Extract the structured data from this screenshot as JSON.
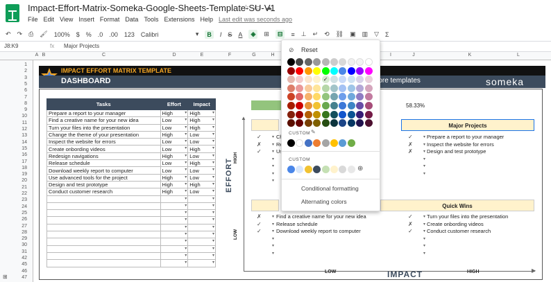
{
  "window": {
    "title": "Impact-Effort-Matrix-Someka-Google-Sheets-Template-SU-V1"
  },
  "menu": [
    "File",
    "Edit",
    "View",
    "Insert",
    "Format",
    "Data",
    "Tools",
    "Extensions",
    "Help"
  ],
  "last_edit": "Last edit was seconds ago",
  "toolbar": {
    "zoom": "100%",
    "currency": "$",
    "percent": "%",
    "dec1": ".0",
    "dec2": ".00",
    "numfmt": "123",
    "font": "Calibri",
    "bold": "B",
    "italic": "I",
    "strike": "S",
    "textcolor": "A"
  },
  "formula": {
    "namebox": "J8:K9",
    "fx": "fx",
    "value": "Major Projects"
  },
  "columns": [
    "A",
    "B",
    "C",
    "D",
    "E",
    "F",
    "G",
    "H",
    "I",
    "J",
    "K",
    "L"
  ],
  "rows": [
    "1",
    "2",
    "3",
    "5",
    "6",
    "7",
    "8",
    "9",
    "10",
    "11",
    "12",
    "13",
    "14",
    "15",
    "16",
    "17",
    "18",
    "19",
    "20",
    "21",
    "22",
    "23",
    "24",
    "25",
    "26",
    "27",
    "28",
    "29",
    "30",
    "31",
    "42",
    "45",
    "46",
    "47"
  ],
  "banner": {
    "title": "IMPACT EFFORT MATRIX TEMPLATE",
    "dashboard": "DASHBOARD",
    "more": "more templates",
    "brand": "someka"
  },
  "tasks": {
    "headers": [
      "Tasks",
      "Effort",
      "Impact"
    ],
    "rows": [
      [
        "Prepare a report to your manager",
        "High",
        "High"
      ],
      [
        "Find a creative name for your new idea",
        "Low",
        "High"
      ],
      [
        "Turn your files into the presentation",
        "Low",
        "High"
      ],
      [
        "Change the theme of your presentation",
        "High",
        "Low"
      ],
      [
        "Inspect the website for errors",
        "Low",
        "Low"
      ],
      [
        "Create onbording videos",
        "Low",
        "High"
      ],
      [
        "Redesign navigations",
        "High",
        "Low"
      ],
      [
        "Release schedule",
        "Low",
        "High"
      ],
      [
        "Download weekly report to computer",
        "Low",
        "Low"
      ],
      [
        "Use advanced tools for the project",
        "High",
        "Low"
      ],
      [
        "Design and test prototype",
        "High",
        "High"
      ],
      [
        "Conduct customer research",
        "High",
        "Low"
      ]
    ]
  },
  "progress": {
    "value": "58.33%",
    "fraction": 0.5833
  },
  "quadrants": {
    "major": {
      "title": "Major Projects",
      "items": [
        {
          "check": "✓",
          "text": "Prepare a report to your manager"
        },
        {
          "check": "✗",
          "text": "Inspect the website for errors"
        },
        {
          "check": "✗",
          "text": "Design and test prototype"
        }
      ]
    },
    "quick": {
      "title": "Quick Wins",
      "items": [
        {
          "check": "✓",
          "text": "Turn your files into the presentation"
        },
        {
          "check": "✗",
          "text": "Create onbording videos"
        },
        {
          "check": "✓",
          "text": "Conduct customer research"
        }
      ]
    },
    "fillin": {
      "items": [
        {
          "check": "✗",
          "text": "Find a creative name for your new idea"
        },
        {
          "check": "✓",
          "text": "Release schedule"
        },
        {
          "check": "✓",
          "text": "Download weekly report to computer"
        }
      ]
    },
    "thankless": {
      "partial": [
        {
          "check": "✓",
          "text": "Ch"
        },
        {
          "check": "✗",
          "text": "Re"
        },
        {
          "check": "✓",
          "text": "Us"
        }
      ]
    }
  },
  "axes": {
    "y": "EFFORT",
    "x": "IMPACT",
    "high": "HIGH",
    "low": "LOW"
  },
  "popup": {
    "reset": "Reset",
    "custom_label": "CUSTOM",
    "custom2_label": "CUSTOM",
    "conditional": "Conditional formatting",
    "alternating": "Alternating colors",
    "grid": [
      [
        "#000000",
        "#434343",
        "#666666",
        "#999999",
        "#b7b7b7",
        "#cccccc",
        "#d9d9d9",
        "#efefef",
        "#f3f3f3",
        "#ffffff"
      ],
      [
        "#980000",
        "#ff0000",
        "#ff9900",
        "#ffff00",
        "#00ff00",
        "#00ffff",
        "#4a86e8",
        "#0000ff",
        "#9900ff",
        "#ff00ff"
      ],
      [
        "#e6b8af",
        "#f4cccc",
        "#fce5cd",
        "#fff2cc",
        "#d9ead3",
        "#d0e0e3",
        "#c9daf8",
        "#cfe2f3",
        "#d9d2e9",
        "#ead1dc"
      ],
      [
        "#dd7e6b",
        "#ea9999",
        "#f9cb9c",
        "#ffe599",
        "#b6d7a8",
        "#a2c4c9",
        "#a4c2f4",
        "#9fc5e8",
        "#b4a7d6",
        "#d5a6bd"
      ],
      [
        "#cc4125",
        "#e06666",
        "#f6b26b",
        "#ffd966",
        "#93c47d",
        "#76a5af",
        "#6d9eeb",
        "#6fa8dc",
        "#8e7cc3",
        "#c27ba0"
      ],
      [
        "#a61c00",
        "#cc0000",
        "#e69138",
        "#f1c232",
        "#6aa84f",
        "#45818e",
        "#3c78d8",
        "#3d85c6",
        "#674ea7",
        "#a64d79"
      ],
      [
        "#85200c",
        "#990000",
        "#b45f06",
        "#bf9000",
        "#38761d",
        "#134f5c",
        "#1155cc",
        "#0b5394",
        "#351c75",
        "#741b47"
      ],
      [
        "#5b0f00",
        "#660000",
        "#783f04",
        "#7f6000",
        "#274e13",
        "#0c343d",
        "#1c4587",
        "#073763",
        "#20124d",
        "#4c1130"
      ]
    ],
    "custom": [
      "#000000",
      "#ffffff",
      "#4472c4",
      "#ed7d31",
      "#a5a5a5",
      "#ffc000",
      "#5b9bd5",
      "#70ad47"
    ],
    "custom2": [
      "#4a86e8",
      "#d9e7fb",
      "#f1c232",
      "#3c4b5d",
      "#c5e0b4",
      "#fff2cc",
      "#d9d9d9",
      "#e8e8e8"
    ]
  }
}
